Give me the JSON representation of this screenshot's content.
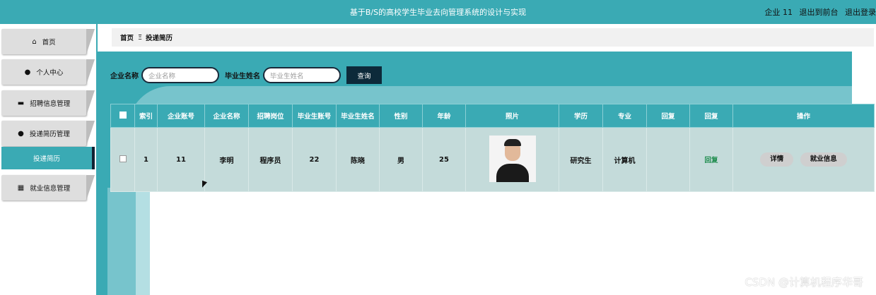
{
  "header": {
    "title": "基于B/S的高校学生毕业去向管理系统的设计与实现",
    "user": "企业 11",
    "front_link": "退出到前台",
    "logout": "退出登录"
  },
  "sidebar": {
    "items": [
      {
        "label": "首页",
        "icon": "home-icon"
      },
      {
        "label": "个人中心",
        "icon": "user-icon"
      },
      {
        "label": "招聘信息管理",
        "icon": "ticket-icon"
      },
      {
        "label": "投递简历管理",
        "icon": "location-pin-icon"
      },
      {
        "label": "就业信息管理",
        "icon": "grid-icon"
      }
    ],
    "active_sub": "投递简历"
  },
  "breadcrumb": {
    "home": "首页",
    "separator": "Ξ",
    "current": "投递简历"
  },
  "search": {
    "company_label": "企业名称",
    "company_placeholder": "企业名称",
    "student_label": "毕业生姓名",
    "student_placeholder": "毕业生姓名",
    "button": "查询"
  },
  "table": {
    "headers": [
      "索引",
      "企业账号",
      "企业名称",
      "招聘岗位",
      "毕业生账号",
      "毕业生姓名",
      "性别",
      "年龄",
      "照片",
      "学历",
      "专业",
      "回复",
      "回复",
      "操作"
    ],
    "row": {
      "index": "1",
      "company_account": "11",
      "company_name": "李明",
      "position": "程序员",
      "student_account": "22",
      "student_name": "陈晓",
      "gender": "男",
      "age": "25",
      "education": "研究生",
      "major": "计算机",
      "reply": "",
      "reply_link": "回复",
      "detail_button": "详情",
      "employment_button": "就业信息"
    }
  },
  "watermark": "CSDN @计算机程序华哥",
  "colors": {
    "accent": "#3aaab4",
    "dark": "#0d2a3a",
    "row_bg": "#c4dbda"
  }
}
